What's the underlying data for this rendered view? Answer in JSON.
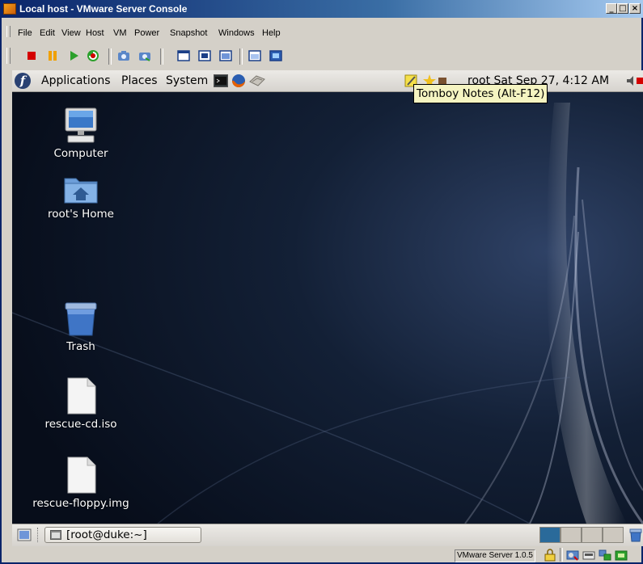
{
  "window": {
    "title": "Local host - VMware Server Console",
    "min_glyph": "_",
    "max_glyph": "□",
    "close_glyph": "×"
  },
  "menubar": {
    "items": [
      "File",
      "Edit",
      "View",
      "Host",
      "VM",
      "Power",
      "Snapshot",
      "Windows",
      "Help"
    ]
  },
  "toolbar": {
    "buttons": [
      "power-off-icon",
      "suspend-icon",
      "power-on-icon",
      "reset-icon",
      "take-snapshot-icon",
      "revert-snapshot-icon",
      "full-screen-icon",
      "quick-switch-icon",
      "summary-view-icon",
      "console-view-icon",
      "appliance-view-icon"
    ]
  },
  "guest": {
    "panel": {
      "menus": [
        "Applications",
        "Places",
        "System"
      ],
      "launchers": [
        "terminal-icon",
        "firefox-icon",
        "email-icon"
      ],
      "clock_text": "root  Sat Sep 27,  4:12 AM",
      "tooltip": "Tomboy Notes (Alt-F12)"
    },
    "desktop_icons": [
      {
        "label": "Computer",
        "icon": "computer-icon"
      },
      {
        "label": "root's Home",
        "icon": "home-folder-icon"
      },
      {
        "label": "Trash",
        "icon": "trash-icon"
      },
      {
        "label": "rescue-cd.iso",
        "icon": "file-icon"
      },
      {
        "label": "rescue-floppy.img",
        "icon": "file-icon"
      }
    ],
    "taskbar": {
      "window_button": "[root@duke:~]"
    }
  },
  "statusbar": {
    "version": "VMware Server 1.0.5"
  },
  "colors": {
    "title_active": "#0a246a",
    "desktop_bg": "#0c1628",
    "tooltip_bg": "#f5f4c1",
    "workspace_active": "#2a6a9a"
  }
}
